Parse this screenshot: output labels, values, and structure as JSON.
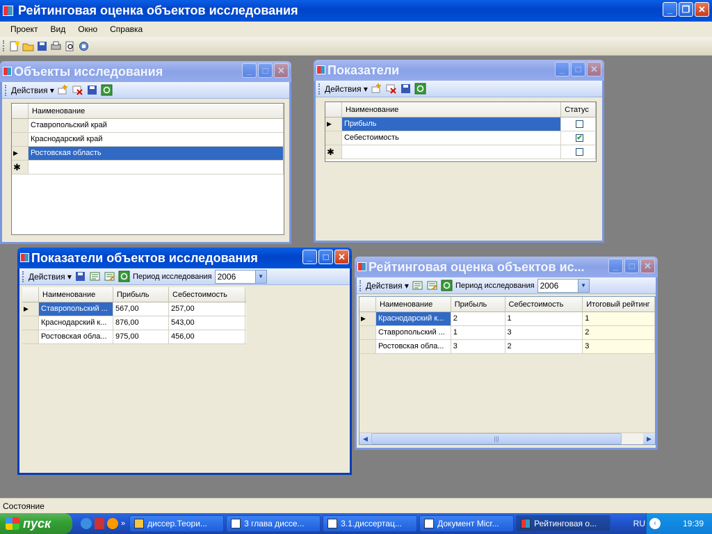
{
  "app": {
    "title": "Рейтинговая оценка объектов исследования"
  },
  "menu": [
    "Проект",
    "Вид",
    "Окно",
    "Справка"
  ],
  "windows": {
    "objects": {
      "title": "Объекты исследования",
      "actions": "Действия",
      "columns": [
        "Наименование"
      ],
      "rows": [
        "Ставропольский край",
        "Краснодарский край",
        "Ростовская область"
      ]
    },
    "indicators": {
      "title": "Показатели",
      "actions": "Действия",
      "columns": [
        "Наименование",
        "Статус"
      ],
      "rows": [
        {
          "name": "Прибыль",
          "checked": false
        },
        {
          "name": "Себестоимость",
          "checked": true
        }
      ]
    },
    "object_indicators": {
      "title": "Показатели объектов исследования",
      "actions": "Действия",
      "period_label": "Период исследования",
      "period_value": "2006",
      "columns": [
        "Наименование",
        "Прибыль",
        "Себестоимость"
      ],
      "rows": [
        [
          "Ставропольский ...",
          "567,00",
          "257,00"
        ],
        [
          "Краснодарский к...",
          "876,00",
          "543,00"
        ],
        [
          "Ростовская обла...",
          "975,00",
          "456,00"
        ]
      ]
    },
    "rating": {
      "title": "Рейтинговая оценка объектов ис...",
      "actions": "Действия",
      "period_label": "Период исследования",
      "period_value": "2006",
      "columns": [
        "Наименование",
        "Прибыль",
        "Себестоимость",
        "Итоговый рейтинг"
      ],
      "rows": [
        [
          "Краснодарский к...",
          "2",
          "1",
          "1"
        ],
        [
          "Ставропольский ...",
          "1",
          "3",
          "2"
        ],
        [
          "Ростовская обла...",
          "3",
          "2",
          "3"
        ]
      ]
    }
  },
  "status": "Состояние",
  "taskbar": {
    "start": "пуск",
    "items": [
      "диссер.Теори...",
      "3 глава диссе...",
      "3.1.диссертац...",
      "Документ Micr...",
      "Рейтинговая о..."
    ],
    "lang": "RU",
    "time": "19:39"
  },
  "colors": {
    "title_active": "#0a5ee5",
    "title_inactive": "#8aa2e6",
    "selection": "#316ac5"
  }
}
